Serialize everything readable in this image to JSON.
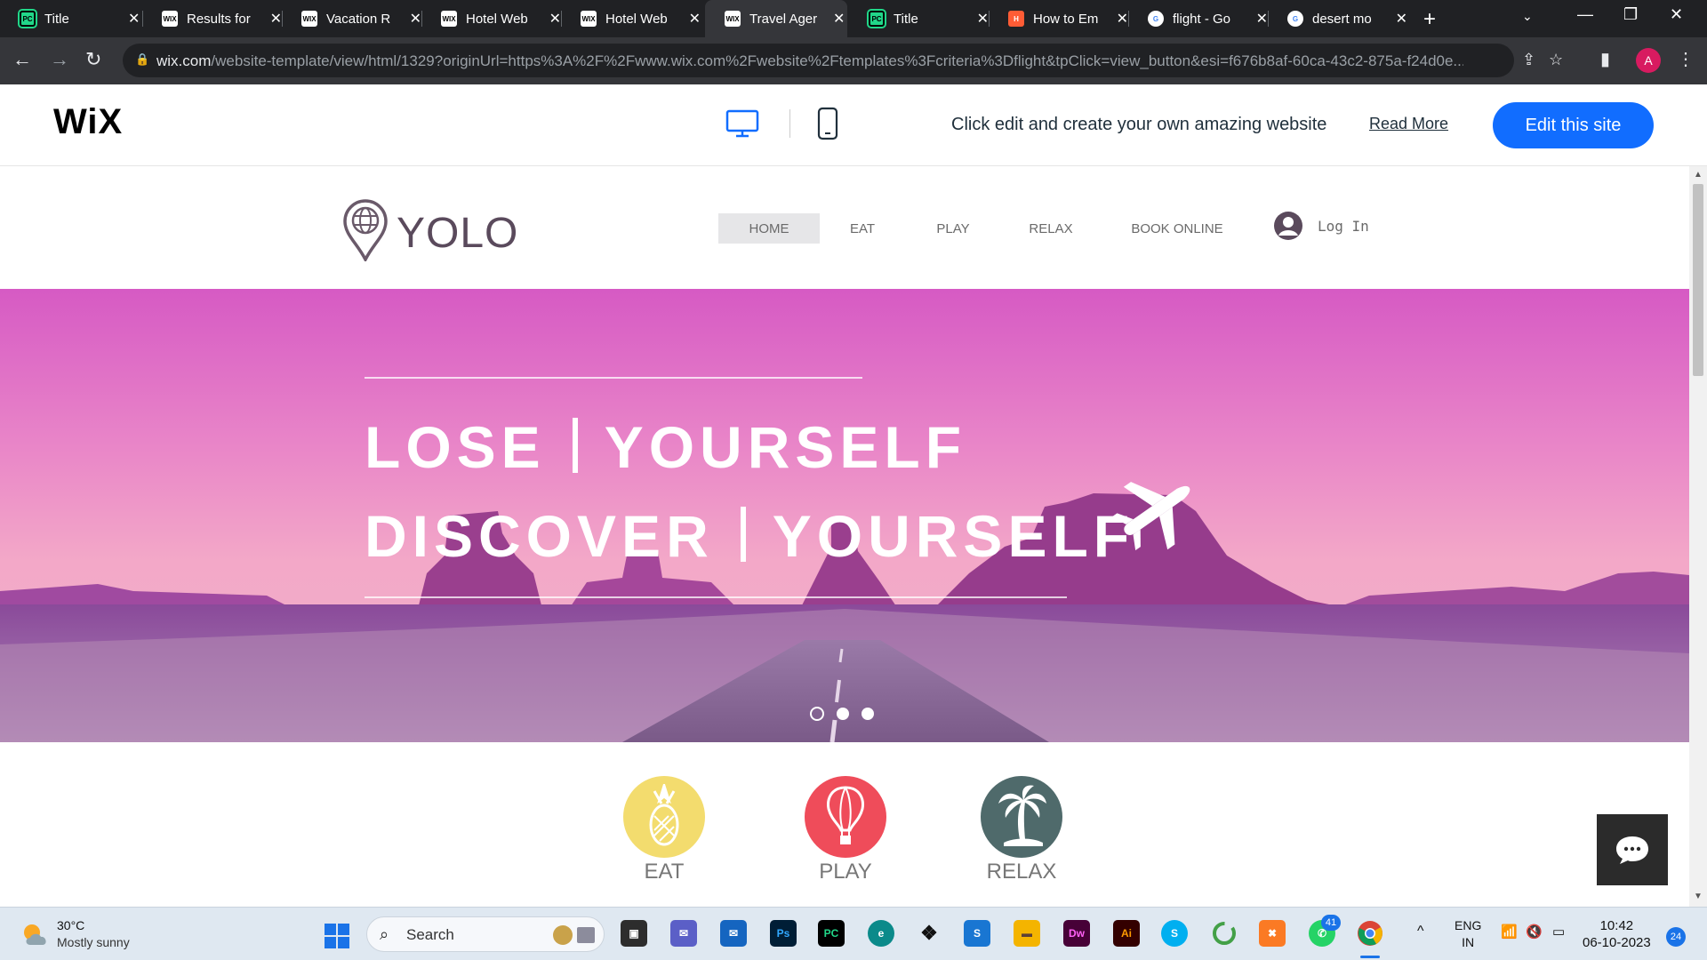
{
  "browser": {
    "tabs": [
      {
        "title": "Title",
        "favicon": "pycharm-icon"
      },
      {
        "title": "Results for",
        "favicon": "wix-icon"
      },
      {
        "title": "Vacation R",
        "favicon": "wix-icon"
      },
      {
        "title": "Hotel Web",
        "favicon": "wix-icon"
      },
      {
        "title": "Hotel Web",
        "favicon": "wix-icon"
      },
      {
        "title": "Travel Ager",
        "favicon": "wix-icon",
        "active": true
      },
      {
        "title": "Title",
        "favicon": "pycharm-icon"
      },
      {
        "title": "How to Em",
        "favicon": "hubspot-icon"
      },
      {
        "title": "flight - Go",
        "favicon": "google-icon"
      },
      {
        "title": "desert mo",
        "favicon": "google-icon"
      }
    ],
    "url_host": "wix.com",
    "url_rest": "/website-template/view/html/1329?originUrl=https%3A%2F%2Fwww.wix.com%2Fwebsite%2Ftemplates%3Fcriteria%3Dflight&tpClick=view_button&esi=f676b8af-60ca-43c2-875a-f24d0e...",
    "profile_initial": "A"
  },
  "wix_bar": {
    "logo": "WiX",
    "message": "Click edit and create your own amazing website",
    "read_more": "Read More",
    "edit_button": "Edit this site",
    "accent": "#116dff"
  },
  "site": {
    "logo_text": "YOLO",
    "nav": [
      "HOME",
      "EAT",
      "PLAY",
      "RELAX",
      "BOOK ONLINE"
    ],
    "active_nav": "HOME",
    "login": "Log In"
  },
  "hero": {
    "line1_a": "LOSE",
    "line1_b": "YOURSELF",
    "line2_a": "DISCOVER",
    "line2_b": "YOURSELF",
    "slides": 3,
    "active_slide": 1
  },
  "features": [
    {
      "label": "EAT",
      "color": "#f3dc6e",
      "icon": "pineapple-icon"
    },
    {
      "label": "PLAY",
      "color": "#ef4c5a",
      "icon": "hot-air-balloon-icon"
    },
    {
      "label": "RELAX",
      "color": "#4f6a6b",
      "icon": "palm-tree-icon"
    }
  ],
  "taskbar": {
    "weather_temp": "30°C",
    "weather_desc": "Mostly sunny",
    "search_placeholder": "Search",
    "whatsapp_badge": "41",
    "lang_1": "ENG",
    "lang_2": "IN",
    "time": "10:42",
    "date": "06-10-2023",
    "notifications": "24"
  }
}
